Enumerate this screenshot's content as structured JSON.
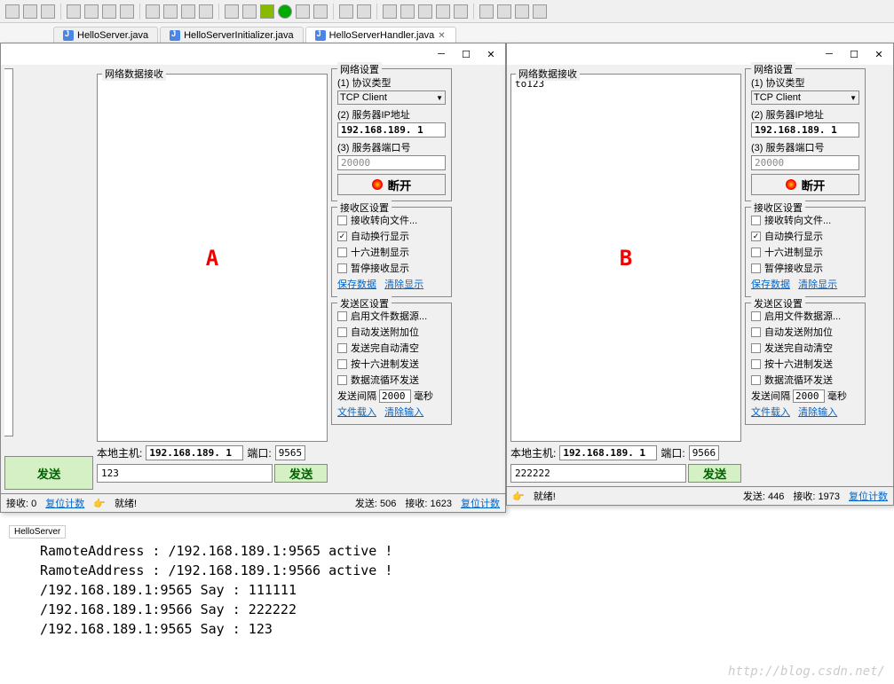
{
  "tabs": [
    {
      "label": "HelloServer.java"
    },
    {
      "label": "HelloServerInitializer.java"
    },
    {
      "label": "HelloServerHandler.java",
      "active": true
    }
  ],
  "labels": {
    "recv_area": "网络数据接收",
    "local_host": "本地主机:",
    "port": "端口:",
    "send": "发送",
    "ready": "就绪!",
    "sent": "发送:",
    "recv": "接收:",
    "reset": "复位计数",
    "net_settings": "网络设置",
    "proto_type": "(1) 协议类型",
    "server_ip": "(2) 服务器IP地址",
    "server_port": "(3) 服务器端口号",
    "disconnect": "断开",
    "recv_settings": "接收区设置",
    "recv_to_file": "接收转向文件...",
    "auto_wrap": "自动换行显示",
    "hex_display": "十六进制显示",
    "pause_recv": "暂停接收显示",
    "save_data": "保存数据",
    "clear_display": "清除显示",
    "send_settings": "发送区设置",
    "file_source": "启用文件数据源...",
    "auto_append": "自动发送附加位",
    "auto_clear": "发送完自动清空",
    "hex_send": "按十六进制发送",
    "loop_send": "数据流循环发送",
    "interval": "发送间隔",
    "ms": "毫秒",
    "file_load": "文件载入",
    "clear_input": "清除输入"
  },
  "windowA": {
    "marker": "A",
    "recv_content": "",
    "local_ip": "192.168.189. 1",
    "local_port": "9565",
    "send_text": "123",
    "proto": "TCP Client",
    "server_ip": "192.168.189. 1",
    "server_port": "20000",
    "interval": "2000",
    "sent_count": "506",
    "recv_count": "0",
    "auto_wrap_checked": true
  },
  "windowB": {
    "marker": "B",
    "recv_content": "to123",
    "local_ip": "192.168.189. 1",
    "local_port": "9566",
    "send_text": "222222",
    "proto": "TCP Client",
    "server_ip": "192.168.189. 1",
    "server_port": "20000",
    "interval": "2000",
    "sent_count": "446",
    "recv_count_a": "1623",
    "recv_count_b": "1973",
    "auto_wrap_checked": true
  },
  "console_tab": "HelloServer",
  "console": [
    "RamoteAddress : /192.168.189.1:9565 active !",
    "RamoteAddress : /192.168.189.1:9566 active !",
    "/192.168.189.1:9565 Say : 111111",
    "/192.168.189.1:9566 Say : 222222",
    "/192.168.189.1:9565 Say : 123"
  ],
  "watermark": "http://blog.csdn.net/"
}
